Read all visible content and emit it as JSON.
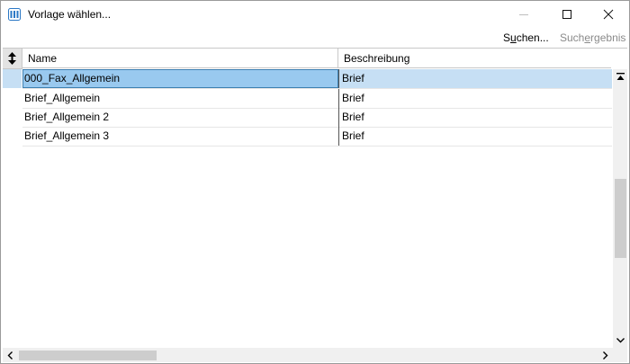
{
  "window": {
    "title": "Vorlage wählen..."
  },
  "toolbar": {
    "search_pre": "S",
    "search_ul": "u",
    "search_post": "chen...",
    "result_pre": "Such",
    "result_ul": "e",
    "result_post": "rgebnis"
  },
  "grid": {
    "columns": [
      "Name",
      "Beschreibung"
    ],
    "rows": [
      {
        "name": "000_Fax_Allgemein",
        "desc": "Brief",
        "selected": true
      },
      {
        "name": "Brief_Allgemein",
        "desc": "Brief"
      },
      {
        "name": "Brief_Allgemein 2",
        "desc": "Brief"
      },
      {
        "name": "Brief_Allgemein 3",
        "desc": "Brief"
      }
    ]
  },
  "icons": {
    "app": "app-icon",
    "minimize": "minimize-icon",
    "maximize": "maximize-icon",
    "close": "close-icon",
    "sort": "sort-updown-icon"
  },
  "colors": {
    "selection_row": "#c6dff4",
    "selection_cell": "#99c9ef",
    "app_icon": "#2b78c5"
  }
}
